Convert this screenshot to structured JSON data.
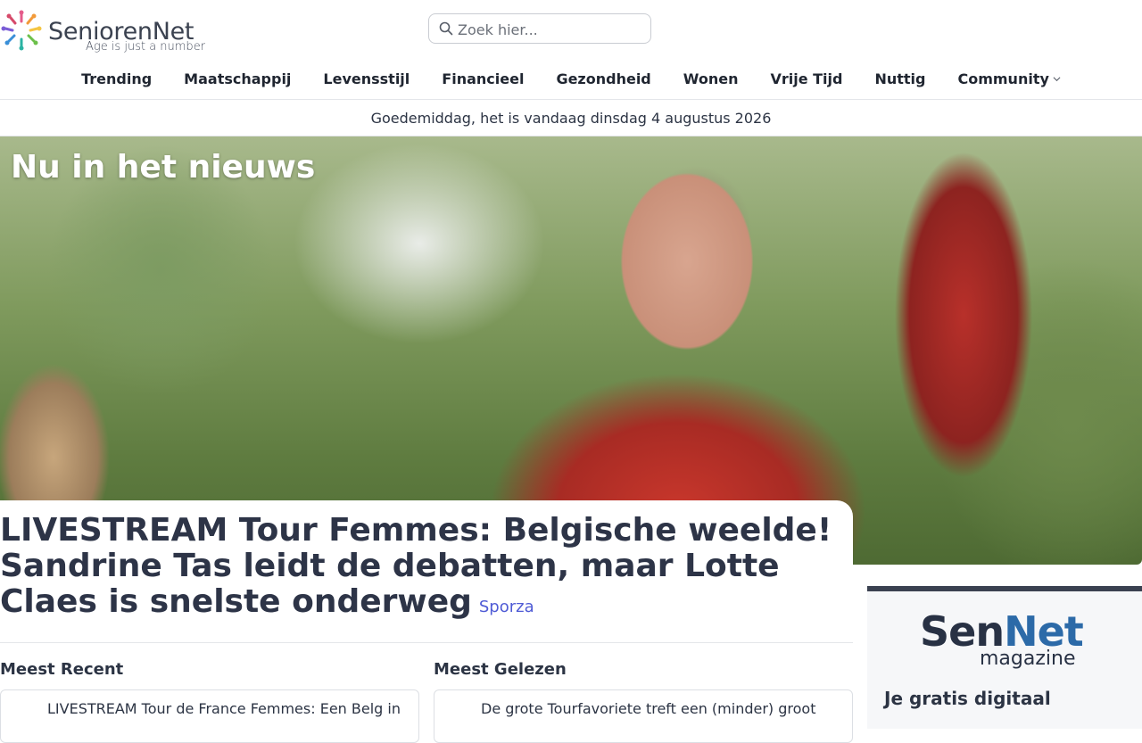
{
  "brand": {
    "name": "SeniorenNet",
    "tagline": "Age is just a number"
  },
  "search": {
    "placeholder": "Zoek hier..."
  },
  "nav": {
    "items": [
      "Trending",
      "Maatschappij",
      "Levensstijl",
      "Financieel",
      "Gezondheid",
      "Wonen",
      "Vrije Tijd",
      "Nuttig",
      "Community"
    ]
  },
  "greeting": "Goedemiddag, het is vandaag dinsdag 4 augustus 2026",
  "hero": {
    "section_title": "Nu in het nieuws",
    "headline": "LIVESTREAM Tour Femmes: Belgische weelde! Sandrine Tas leidt de debatten, maar Lotte Claes is snelste onderweg",
    "source": "Sporza"
  },
  "recent": {
    "title": "Meest Recent",
    "first_item": "LIVESTREAM Tour de France Femmes: Een Belg in"
  },
  "popular": {
    "title": "Meest Gelezen",
    "first_item": "De grote Tourfavoriete treft een (minder) groot"
  },
  "magazine": {
    "sen": "Sen",
    "net": "Net",
    "sub": "magazine",
    "promo": "Je gratis digitaal"
  },
  "colors": {
    "text": "#2c3444",
    "source_link": "#4f5bd5",
    "magazine_accent": "#2c6aa8"
  }
}
